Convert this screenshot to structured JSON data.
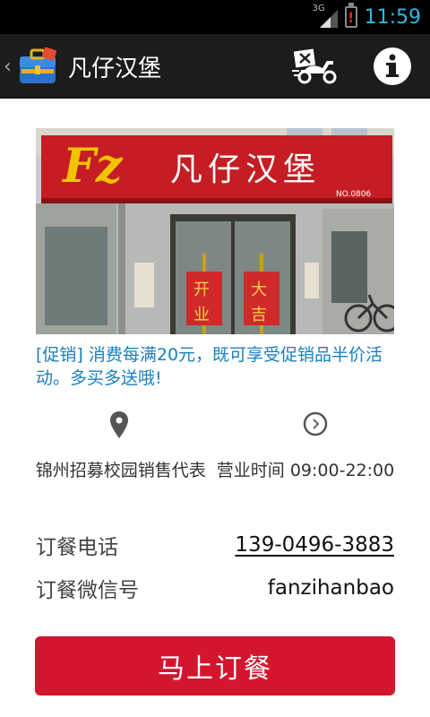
{
  "status_bar": {
    "network": "3G",
    "time": "11:59"
  },
  "action_bar": {
    "back_icon": "chevron-left-icon",
    "app_icon": "briefcase-app-icon",
    "title": "凡仔汉堡",
    "delivery_icon": "delivery-scooter-icon",
    "info_icon": "info-icon"
  },
  "store": {
    "sign_name": "凡仔汉堡",
    "sign_logo": "Fz",
    "sign_number": "NO.0806",
    "door_chars": [
      "开",
      "大",
      "业",
      "吉"
    ],
    "promo": "[促销] 消费每满20元，既可享受促销品半价活动。多买多送哦!",
    "location": "锦州招募校园销售代表",
    "hours": "营业时间 09:00-22:00"
  },
  "contact": {
    "phone_label": "订餐电话",
    "phone_value": "139-0496-3883",
    "wechat_label": "订餐微信号",
    "wechat_value": "fanzihanbao"
  },
  "order_button": {
    "label": "马上订餐"
  },
  "colors": {
    "accent_blue": "#1a7fc1",
    "button_red": "#d3162e",
    "action_bar": "#1c1c1c",
    "clock_blue": "#33b5e5"
  }
}
